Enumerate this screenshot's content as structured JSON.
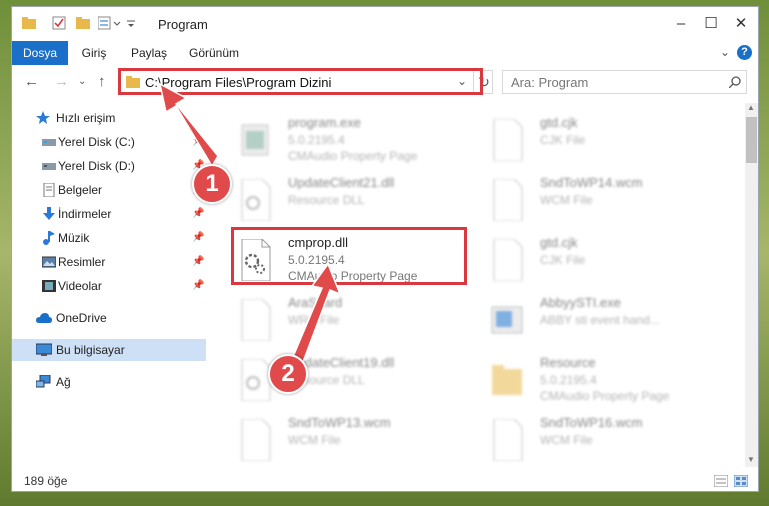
{
  "window": {
    "title": "Program"
  },
  "ribbon": {
    "tabs": [
      "Dosya",
      "Giriş",
      "Paylaş",
      "Görünüm"
    ]
  },
  "address": {
    "path": "C:\\Program Files\\Program Dizini"
  },
  "search": {
    "placeholder": "Ara: Program"
  },
  "sidebar": {
    "items": [
      {
        "label": "Hızlı erişim"
      },
      {
        "label": "Yerel Disk (C:)"
      },
      {
        "label": "Yerel Disk (D:)"
      },
      {
        "label": "Belgeler"
      },
      {
        "label": "İndirmeler"
      },
      {
        "label": "Müzik"
      },
      {
        "label": "Resimler"
      },
      {
        "label": "Videolar"
      },
      {
        "label": "OneDrive"
      },
      {
        "label": "Bu bilgisayar"
      },
      {
        "label": "Ağ"
      }
    ]
  },
  "files": [
    {
      "name": "program.exe",
      "l1": "5.0.2195.4",
      "l2": "CMAudio Property Page"
    },
    {
      "name": "gtd.cjk",
      "l1": "CJK File",
      "l2": ""
    },
    {
      "name": "UpdateClient21.dll",
      "l1": "Resource DLL",
      "l2": ""
    },
    {
      "name": "SndToWP14.wcm",
      "l1": "WCM File",
      "l2": ""
    },
    {
      "name": "cmprop.dll",
      "l1": "5.0.2195.4",
      "l2": "CMAudio Property Page"
    },
    {
      "name": "gtd.cjk",
      "l1": "CJK File",
      "l2": ""
    },
    {
      "name": "AraScard",
      "l1": "WRC File",
      "l2": ""
    },
    {
      "name": "AbbyySTI.exe",
      "l1": "ABBY sti event hand...",
      "l2": ""
    },
    {
      "name": "UpdateClient19.dll",
      "l1": "Resource DLL",
      "l2": ""
    },
    {
      "name": "Resource",
      "l1": "5.0.2195.4",
      "l2": "CMAudio Property Page"
    },
    {
      "name": "SndToWP13.wcm",
      "l1": "WCM File",
      "l2": ""
    },
    {
      "name": "SndToWP16.wcm",
      "l1": "WCM File",
      "l2": ""
    }
  ],
  "status": {
    "count": "189 öğe"
  },
  "markers": [
    "1",
    "2"
  ],
  "colors": {
    "accent": "#1a6fc9",
    "highlight": "#d9393e",
    "selected": "#cde0f5"
  }
}
